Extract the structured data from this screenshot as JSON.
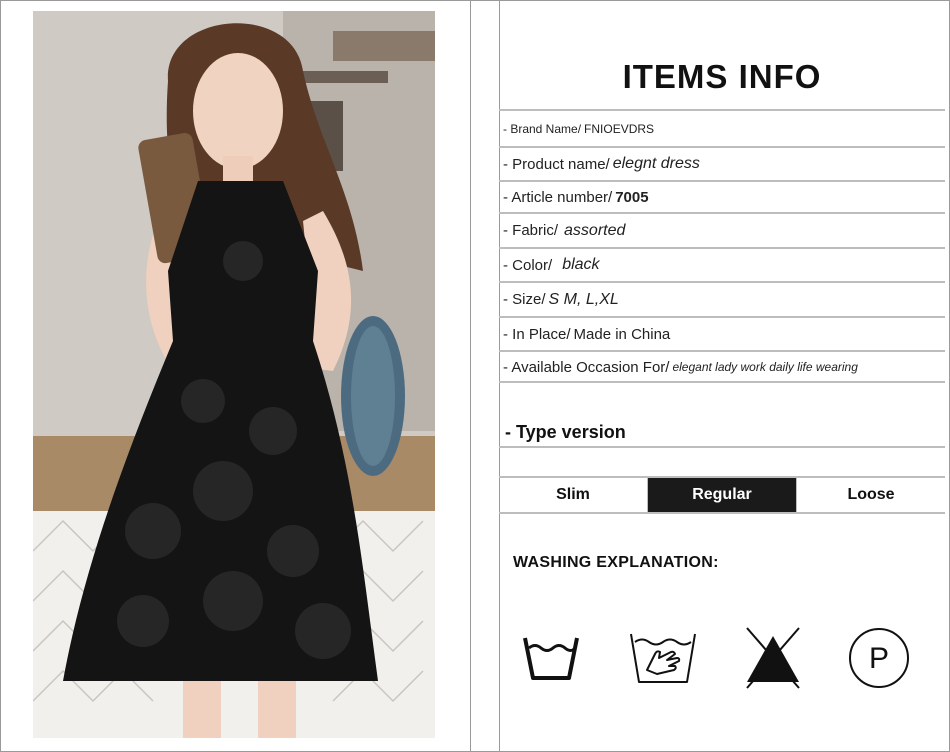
{
  "header": {
    "title": "ITEMS INFO"
  },
  "specs": [
    {
      "label": "- Brand Name/",
      "value": "FNIOEVDRS"
    },
    {
      "label": "- Product name/",
      "value": "elegnt dress"
    },
    {
      "label": "- Article number/",
      "value": "7005"
    },
    {
      "label": "- Fabric/",
      "value": "assorted"
    },
    {
      "label": "- Color/",
      "value": "black"
    },
    {
      "label": "- Size/",
      "value": "S M, L,XL"
    },
    {
      "label": "- In Place/",
      "value": "Made in China"
    },
    {
      "label": "- Available Occasion For/",
      "value": "elegant lady work daily life wearing"
    }
  ],
  "type_version": {
    "title": "- Type version",
    "options": [
      "Slim",
      "Regular",
      "Loose"
    ],
    "selected": "Regular"
  },
  "washing": {
    "title": "WASHING EXPLANATION:",
    "icons": [
      "machine-wash-icon",
      "hand-wash-icon",
      "do-not-bleach-icon",
      "dry-clean-p-icon"
    ],
    "dry_clean_letter": "P"
  },
  "colors": {
    "accent": "#1a1a1a",
    "rule": "#bdbdbd"
  }
}
